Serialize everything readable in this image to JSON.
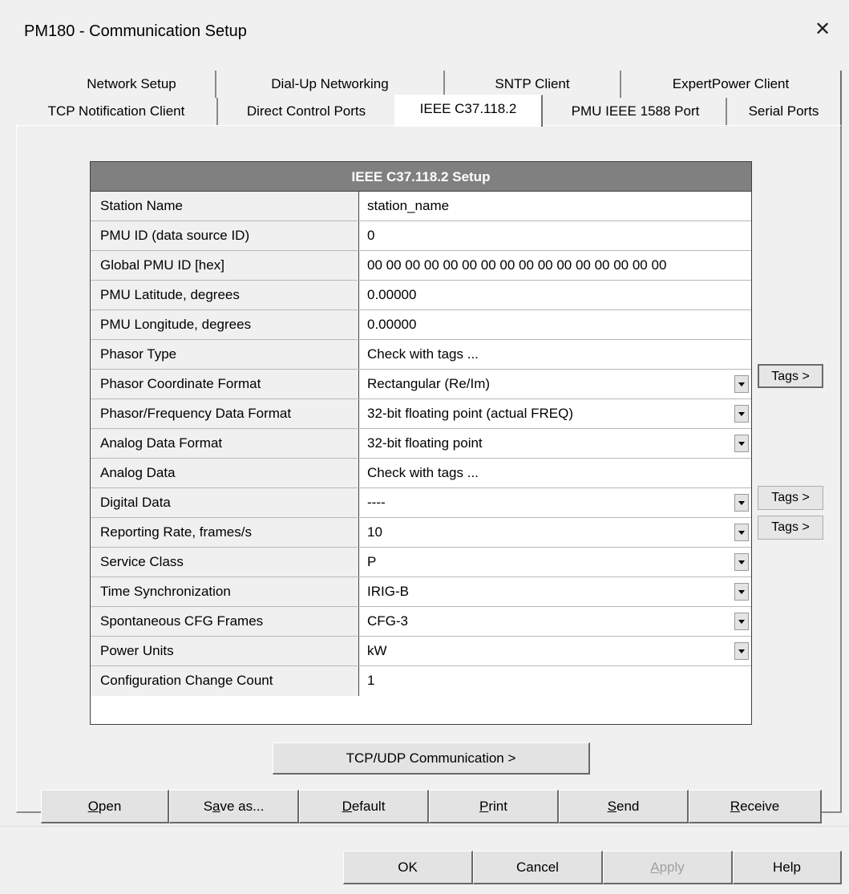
{
  "window": {
    "title": "PM180 - Communication Setup",
    "close_glyph": "✕"
  },
  "tabs": {
    "row1": [
      {
        "label": "Network Setup"
      },
      {
        "label": "Dial-Up Networking"
      },
      {
        "label": "SNTP Client"
      },
      {
        "label": "ExpertPower Client"
      }
    ],
    "row2": [
      {
        "label": "TCP Notification Client"
      },
      {
        "label": "Direct Control Ports"
      },
      {
        "label": "IEEE C37.118.2",
        "active": true
      },
      {
        "label": "PMU IEEE 1588 Port"
      },
      {
        "label": "Serial Ports"
      }
    ]
  },
  "setup": {
    "header": "IEEE C37.118.2 Setup",
    "rows": [
      {
        "label": "Station Name",
        "value": "station_name"
      },
      {
        "label": "PMU ID (data source ID)",
        "value": "0"
      },
      {
        "label": "Global PMU ID [hex]",
        "value": "00 00 00 00 00 00 00 00 00 00 00 00 00 00 00 00"
      },
      {
        "label": "PMU Latitude, degrees",
        "value": "0.00000"
      },
      {
        "label": "PMU Longitude, degrees",
        "value": "0.00000"
      },
      {
        "label": "Phasor Type",
        "value": "Check with tags ..."
      },
      {
        "label": "Phasor Coordinate Format",
        "value": "Rectangular (Re/Im)"
      },
      {
        "label": "Phasor/Frequency Data Format",
        "value": "32-bit floating point (actual FREQ)"
      },
      {
        "label": "Analog Data Format",
        "value": "32-bit floating point"
      },
      {
        "label": "Analog Data",
        "value": "Check with tags ..."
      },
      {
        "label": "Digital Data",
        "value": "----"
      },
      {
        "label": "Reporting Rate, frames/s",
        "value": "10"
      },
      {
        "label": "Service Class",
        "value": "P"
      },
      {
        "label": "Time Synchronization",
        "value": "IRIG-B"
      },
      {
        "label": "Spontaneous CFG Frames",
        "value": "CFG-3"
      },
      {
        "label": "Power Units",
        "value": "kW"
      },
      {
        "label": "Configuration Change Count",
        "value": "1"
      }
    ],
    "tags_label": "Tags >"
  },
  "buttons": {
    "tcp_udp": "TCP/UDP Communication >",
    "open_u": "O",
    "open_rest": "pen",
    "saveas_pre": "S",
    "saveas_u": "a",
    "saveas_rest": "ve as...",
    "default_u": "D",
    "default_rest": "efault",
    "print_u": "P",
    "print_rest": "rint",
    "send_u": "S",
    "send_rest": "end",
    "receive_u": "R",
    "receive_rest": "eceive",
    "ok": "OK",
    "cancel": "Cancel",
    "apply_u": "A",
    "apply_rest": "pply",
    "help": "Help"
  }
}
